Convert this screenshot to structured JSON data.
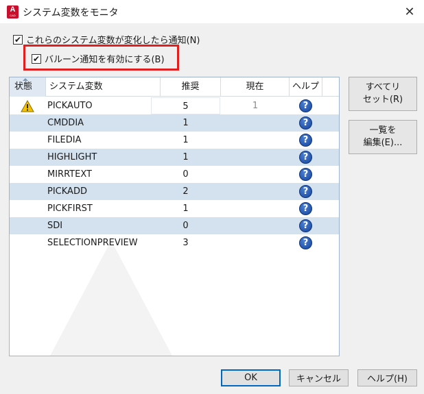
{
  "window": {
    "title": "システム変数をモニタ",
    "app_icon_letter": "A",
    "app_icon_sub": "CAD",
    "close_glyph": "✕"
  },
  "options": {
    "notify_label": "これらのシステム変数が変化したら通知(N)",
    "notify_checked": true,
    "balloon_label": "バルーン通知を有効にする(B)",
    "balloon_checked": true,
    "check_glyph": "✔"
  },
  "table": {
    "columns": [
      "状態",
      "システム変数",
      "推奨",
      "現在",
      "ヘルプ"
    ],
    "help_glyph": "?",
    "rows": [
      {
        "status": "warning-icon",
        "name": "PICKAUTO",
        "recommended": "5",
        "current": "1"
      },
      {
        "status": "",
        "name": "CMDDIA",
        "recommended": "1",
        "current": ""
      },
      {
        "status": "",
        "name": "FILEDIA",
        "recommended": "1",
        "current": ""
      },
      {
        "status": "",
        "name": "HIGHLIGHT",
        "recommended": "1",
        "current": ""
      },
      {
        "status": "",
        "name": "MIRRTEXT",
        "recommended": "0",
        "current": ""
      },
      {
        "status": "",
        "name": "PICKADD",
        "recommended": "2",
        "current": ""
      },
      {
        "status": "",
        "name": "PICKFIRST",
        "recommended": "1",
        "current": ""
      },
      {
        "status": "",
        "name": "SDI",
        "recommended": "0",
        "current": ""
      },
      {
        "status": "",
        "name": "SELECTIONPREVIEW",
        "recommended": "3",
        "current": ""
      }
    ]
  },
  "side_buttons": {
    "reset_all": "すべてリ\nセット(R)",
    "edit_list": "一覧を\n編集(E)..."
  },
  "buttons": {
    "ok": "OK",
    "cancel": "キャンセル",
    "help": "ヘルプ(H)"
  },
  "colors": {
    "alt_row": "#d4e2ef",
    "highlight_border": "#e02020",
    "help_icon": "#1f57b8",
    "warning": "#f2c200"
  }
}
